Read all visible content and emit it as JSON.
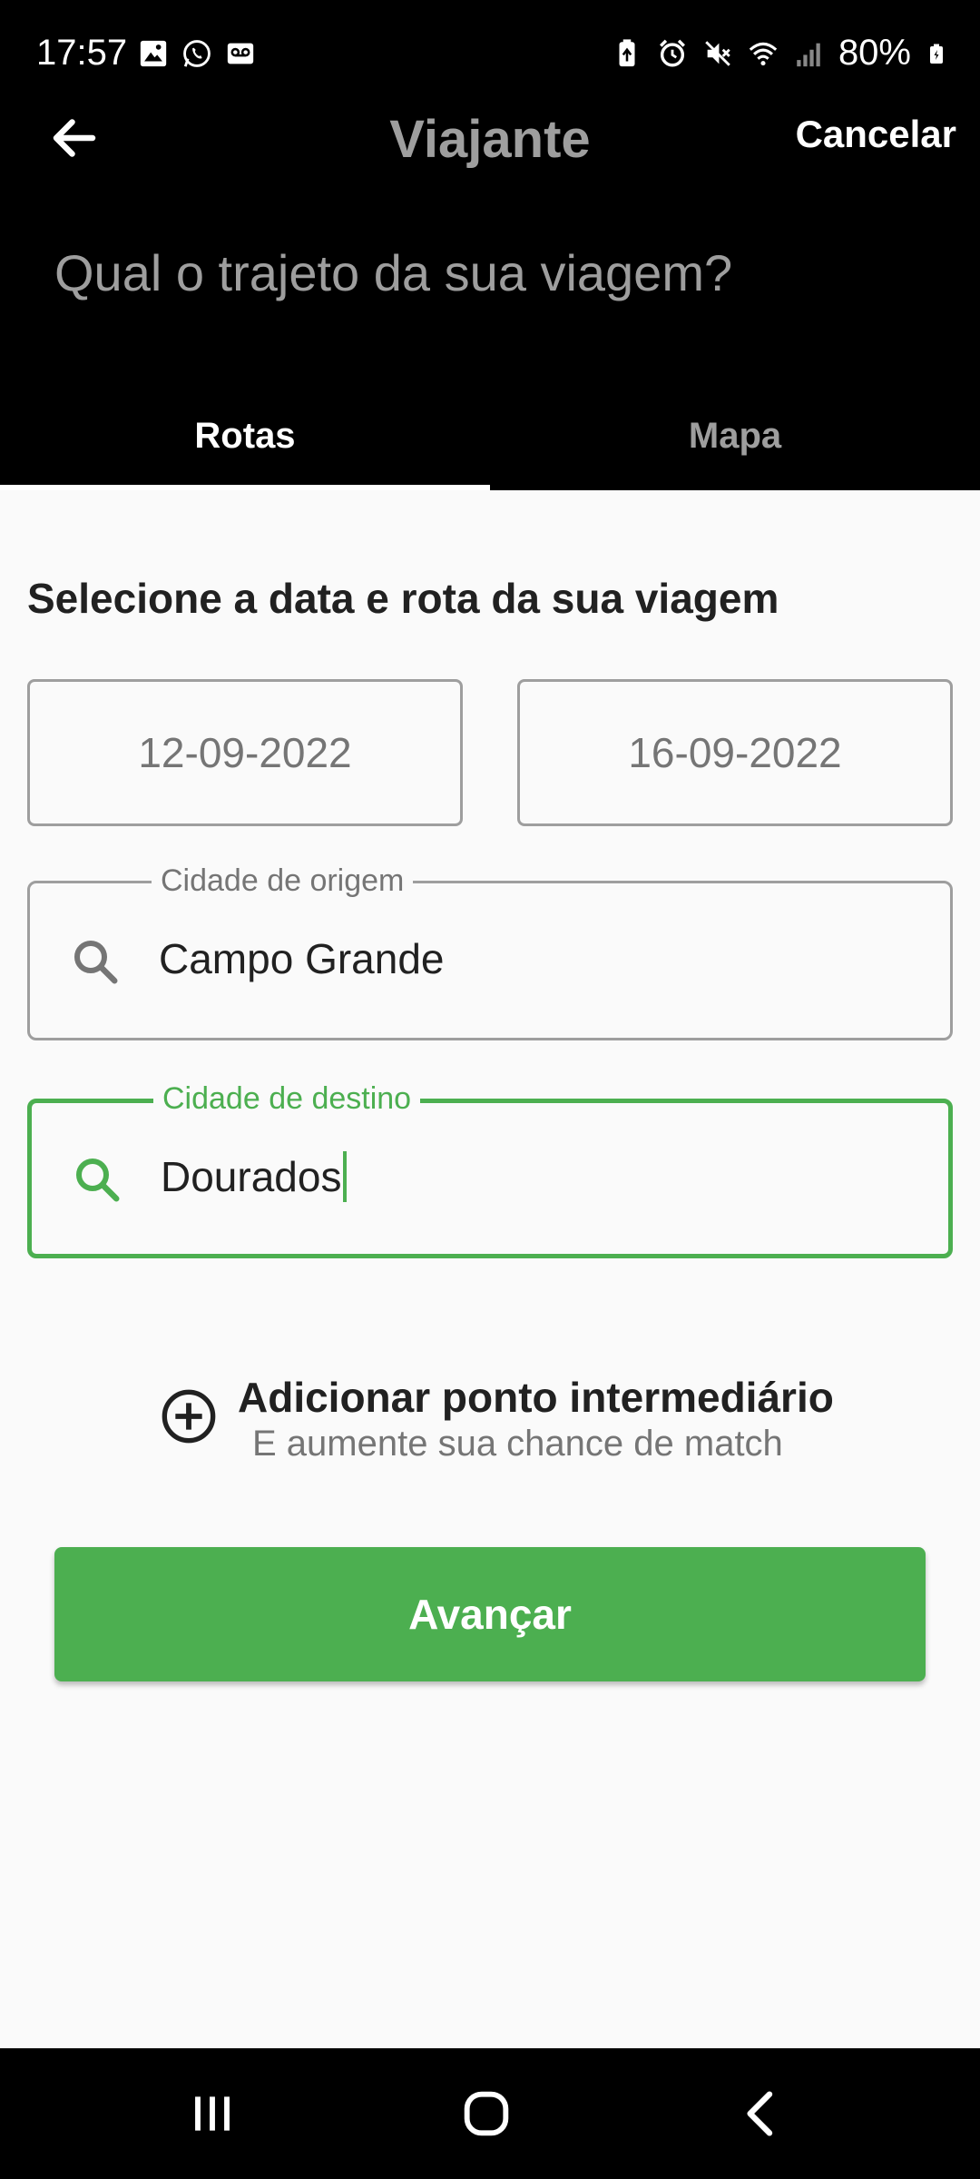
{
  "status_bar": {
    "time": "17:57",
    "battery": "80%",
    "left_icons": [
      "image-icon",
      "whatsapp-icon",
      "voicemail-icon"
    ],
    "right_icons": [
      "battery-saver-icon",
      "alarm-icon",
      "mute-icon",
      "wifi-icon",
      "signal-icon",
      "battery-icon"
    ]
  },
  "app_bar": {
    "title": "Viajante",
    "cancel_label": "Cancelar",
    "back_icon": "arrow-left-icon"
  },
  "header": {
    "question": "Qual o trajeto da sua viagem?"
  },
  "tabs": [
    {
      "label": "Rotas",
      "active": true
    },
    {
      "label": "Mapa",
      "active": false
    }
  ],
  "form": {
    "section_title": "Selecione a data e rota da sua viagem",
    "date_start": "12-09-2022",
    "date_end": "16-09-2022",
    "origin": {
      "label": "Cidade de origem",
      "value": "Campo Grande",
      "icon": "search-icon"
    },
    "destination": {
      "label": "Cidade de destino",
      "value": "Dourados",
      "icon": "search-icon"
    },
    "add_point": {
      "title": "Adicionar ponto intermediário",
      "subtitle": "E aumente sua chance de match",
      "icon": "add-circle-icon"
    },
    "advance_label": "Avançar"
  },
  "nav_bar": {
    "buttons": [
      "recents-icon",
      "home-icon",
      "back-icon"
    ]
  },
  "colors": {
    "accent": "#4caf50",
    "header_bg": "#000000",
    "content_bg": "#fafafa",
    "muted_text": "#9e9e9e"
  }
}
